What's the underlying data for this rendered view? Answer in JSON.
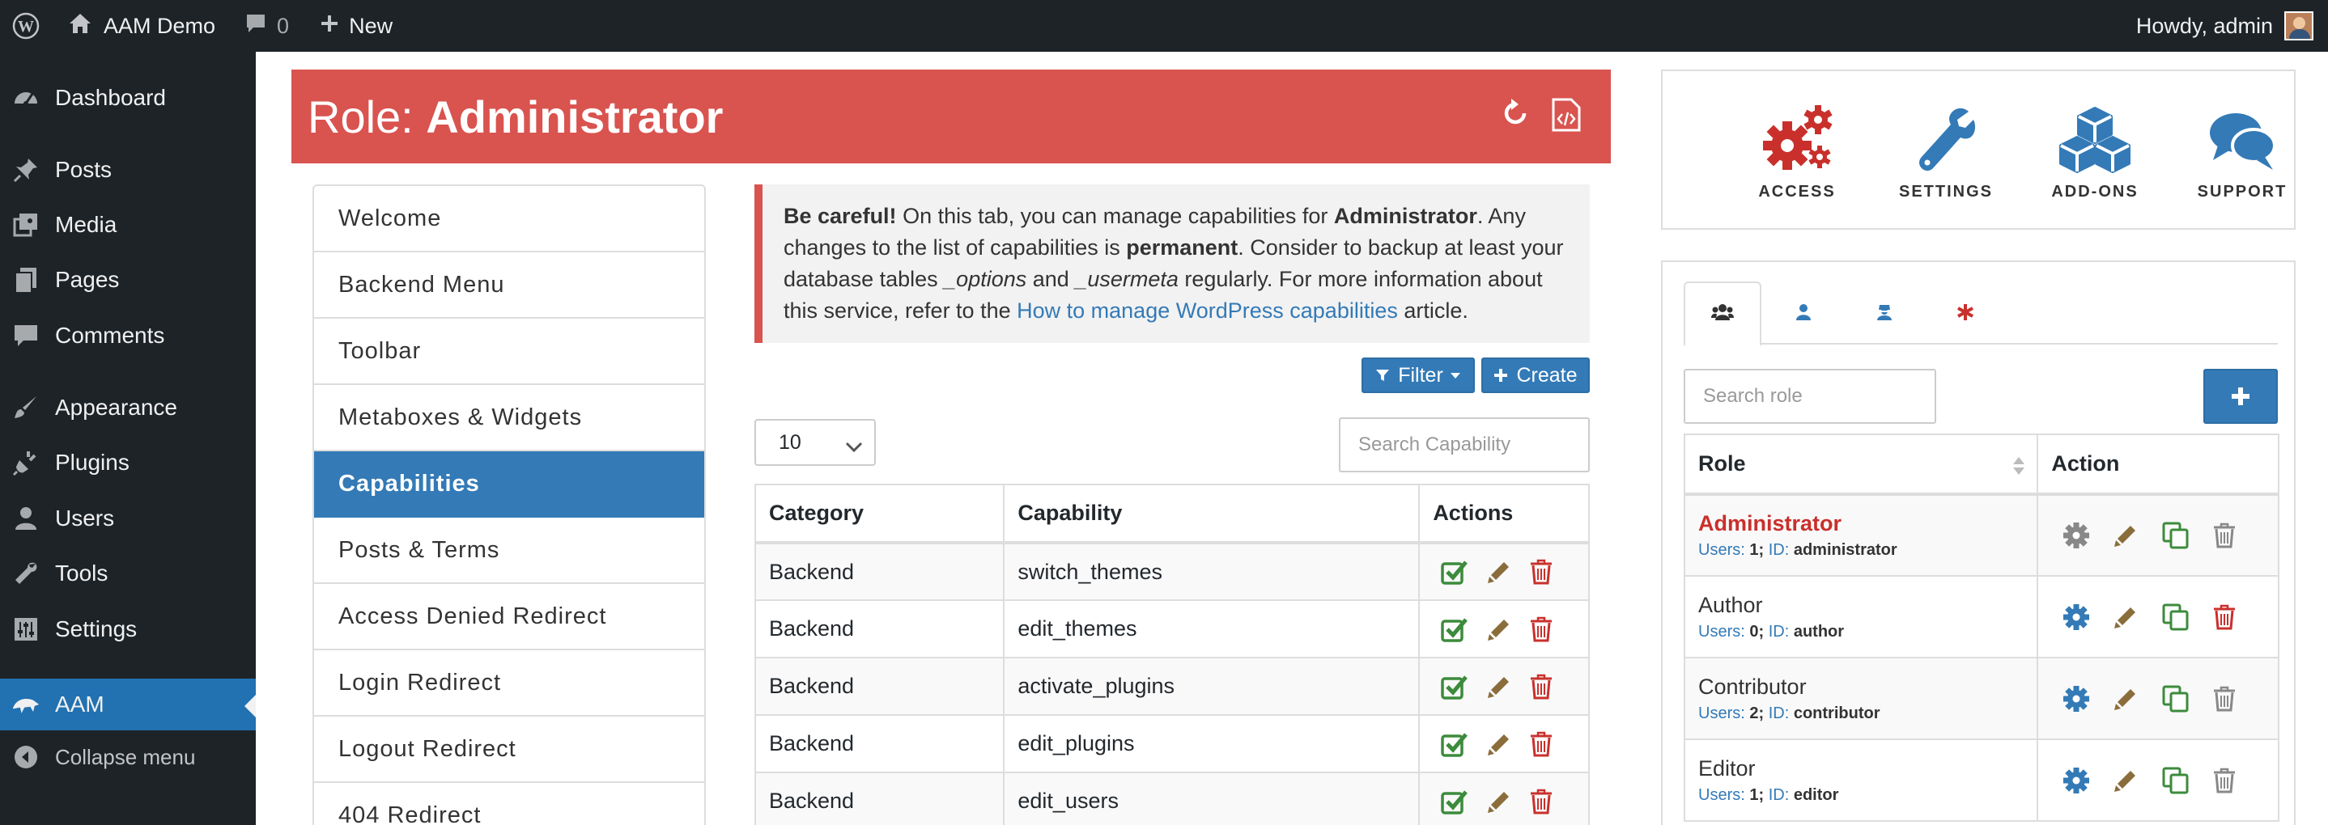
{
  "adminbar": {
    "site": "AAM Demo",
    "comments_count": "0",
    "new_label": "New",
    "greeting": "Howdy, admin"
  },
  "sidebar": {
    "items": [
      {
        "label": "Dashboard",
        "icon": "dashboard-icon"
      },
      {
        "label": "Posts",
        "icon": "pin-icon"
      },
      {
        "label": "Media",
        "icon": "media-icon"
      },
      {
        "label": "Pages",
        "icon": "pages-icon"
      },
      {
        "label": "Comments",
        "icon": "comment-icon"
      },
      {
        "label": "Appearance",
        "icon": "brush-icon"
      },
      {
        "label": "Plugins",
        "icon": "plug-icon"
      },
      {
        "label": "Users",
        "icon": "user-icon"
      },
      {
        "label": "Tools",
        "icon": "wrench-icon"
      },
      {
        "label": "Settings",
        "icon": "sliders-icon"
      },
      {
        "label": "AAM",
        "icon": "aam-icon"
      }
    ],
    "collapse_label": "Collapse menu"
  },
  "role_header": {
    "prefix": "Role:",
    "name": "Administrator"
  },
  "features": [
    "Welcome",
    "Backend Menu",
    "Toolbar",
    "Metaboxes & Widgets",
    "Capabilities",
    "Posts & Terms",
    "Access Denied Redirect",
    "Login Redirect",
    "Logout Redirect",
    "404 Redirect"
  ],
  "active_feature": "Capabilities",
  "alert": {
    "strong": "Be careful!",
    "t1": " On this tab, you can manage capabilities for ",
    "role": "Administrator",
    "t2": ". Any changes to the list of capabilities is ",
    "permanent": "permanent",
    "t3": ". Consider to backup at least your database tables ",
    "table1": "_options",
    "t4": " and ",
    "table2": "_usermeta",
    "t5": " regularly. For more information about this service, refer to the ",
    "link": "How to manage WordPress capabilities",
    "t6": " article."
  },
  "toolbar": {
    "filter_label": "Filter",
    "create_label": "Create"
  },
  "page_size": "10",
  "search_capability_placeholder": "Search Capability",
  "cap_table": {
    "headers": [
      "Category",
      "Capability",
      "Actions"
    ],
    "rows": [
      {
        "category": "Backend",
        "capability": "switch_themes"
      },
      {
        "category": "Backend",
        "capability": "edit_themes"
      },
      {
        "category": "Backend",
        "capability": "activate_plugins"
      },
      {
        "category": "Backend",
        "capability": "edit_plugins"
      },
      {
        "category": "Backend",
        "capability": "edit_users"
      }
    ]
  },
  "nav_tiles": [
    "ACCESS",
    "SETTINGS",
    "ADD-ONS",
    "SUPPORT"
  ],
  "role_panel": {
    "search_placeholder": "Search role",
    "headers": [
      "Role",
      "Action"
    ],
    "labels": {
      "users": "Users:",
      "id": "ID:"
    },
    "roles": [
      {
        "name": "Administrator",
        "users": "1",
        "id": "administrator",
        "current": true
      },
      {
        "name": "Author",
        "users": "0",
        "id": "author",
        "current": false
      },
      {
        "name": "Contributor",
        "users": "2",
        "id": "contributor",
        "current": false
      },
      {
        "name": "Editor",
        "users": "1",
        "id": "editor",
        "current": false
      }
    ]
  },
  "colors": {
    "header_red": "#d9534f",
    "primary_blue": "#337ab7",
    "wp_dark": "#1d2327",
    "wp_blue": "#2271b1",
    "success_green": "#3c8b3c",
    "edit_brown": "#8a6d3b",
    "danger_red": "#c9302c",
    "muted_gray": "#888888"
  }
}
